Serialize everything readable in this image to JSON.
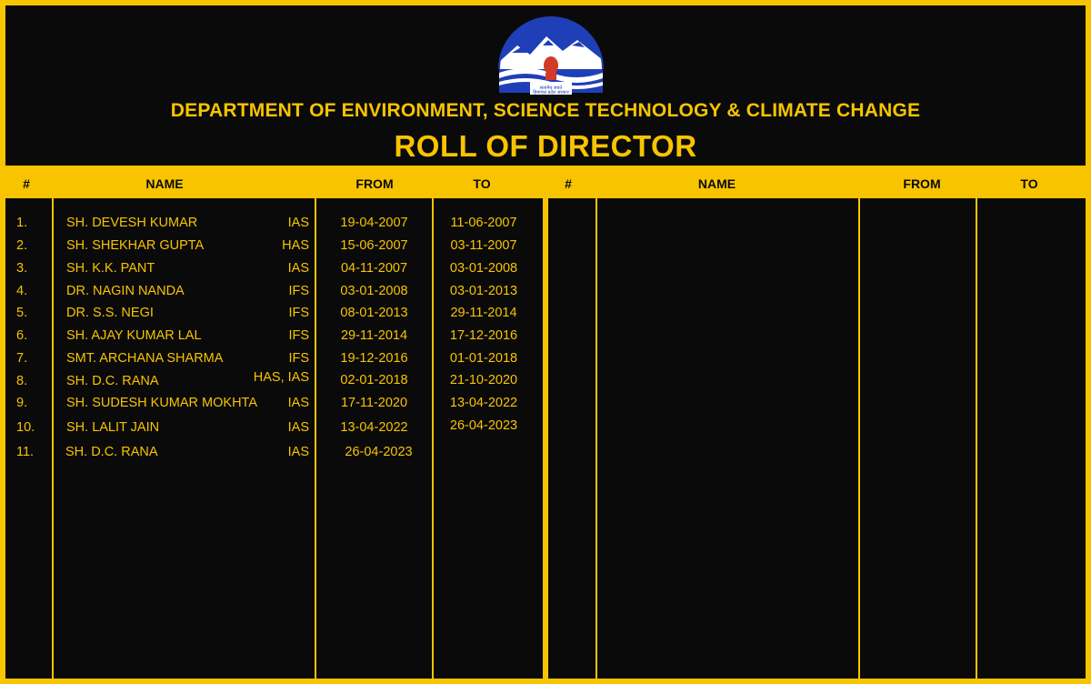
{
  "header": {
    "emblem_motto": "सत्यमेव जयते",
    "emblem_text": "हिमाचल प्रदेश सरकार",
    "department": "DEPARTMENT OF ENVIRONMENT, SCIENCE  TECHNOLOGY & CLIMATE CHANGE",
    "title": "ROLL OF DIRECTOR"
  },
  "columns": {
    "left": [
      "#",
      "NAME",
      "FROM",
      "TO"
    ],
    "right": [
      "#",
      "NAME",
      "FROM",
      "TO"
    ]
  },
  "colors": {
    "accent": "#f8c400",
    "background": "#0a0a0a"
  },
  "rows": [
    {
      "num": "1.",
      "name": "SH. DEVESH KUMAR",
      "service": "IAS",
      "from": "19-04-2007",
      "to": "11-06-2007"
    },
    {
      "num": "2.",
      "name": "SH. SHEKHAR GUPTA",
      "service": "HAS",
      "from": "15-06-2007",
      "to": "03-11-2007"
    },
    {
      "num": "3.",
      "name": "SH. K.K. PANT",
      "service": "IAS",
      "from": "04-11-2007",
      "to": "03-01-2008"
    },
    {
      "num": "4.",
      "name": "DR. NAGIN NANDA",
      "service": "IFS",
      "from": "03-01-2008",
      "to": "03-01-2013"
    },
    {
      "num": "5.",
      "name": "DR. S.S. NEGI",
      "service": "IFS",
      "from": "08-01-2013",
      "to": "29-11-2014"
    },
    {
      "num": "6.",
      "name": "SH. AJAY KUMAR LAL",
      "service": "IFS",
      "from": "29-11-2014",
      "to": "17-12-2016"
    },
    {
      "num": "7.",
      "name": "SMT. ARCHANA SHARMA",
      "service": "IFS",
      "from": "19-12-2016",
      "to": "01-01-2018"
    },
    {
      "num": "8.",
      "name": "SH. D.C. RANA",
      "service": "HAS, IAS",
      "from": "02-01-2018",
      "to": "21-10-2020"
    },
    {
      "num": "9.",
      "name": "SH. SUDESH KUMAR MOKHTA",
      "service": "IAS",
      "from": "17-11-2020",
      "to": "13-04-2022"
    },
    {
      "num": "10.",
      "name": "SH. LALIT JAIN",
      "service": "IAS",
      "from": "13-04-2022",
      "to": "26-04-2023"
    },
    {
      "num": "11.",
      "name": "SH. D.C. RANA",
      "service": "IAS",
      "from": "26-04-2023",
      "to": ""
    }
  ]
}
